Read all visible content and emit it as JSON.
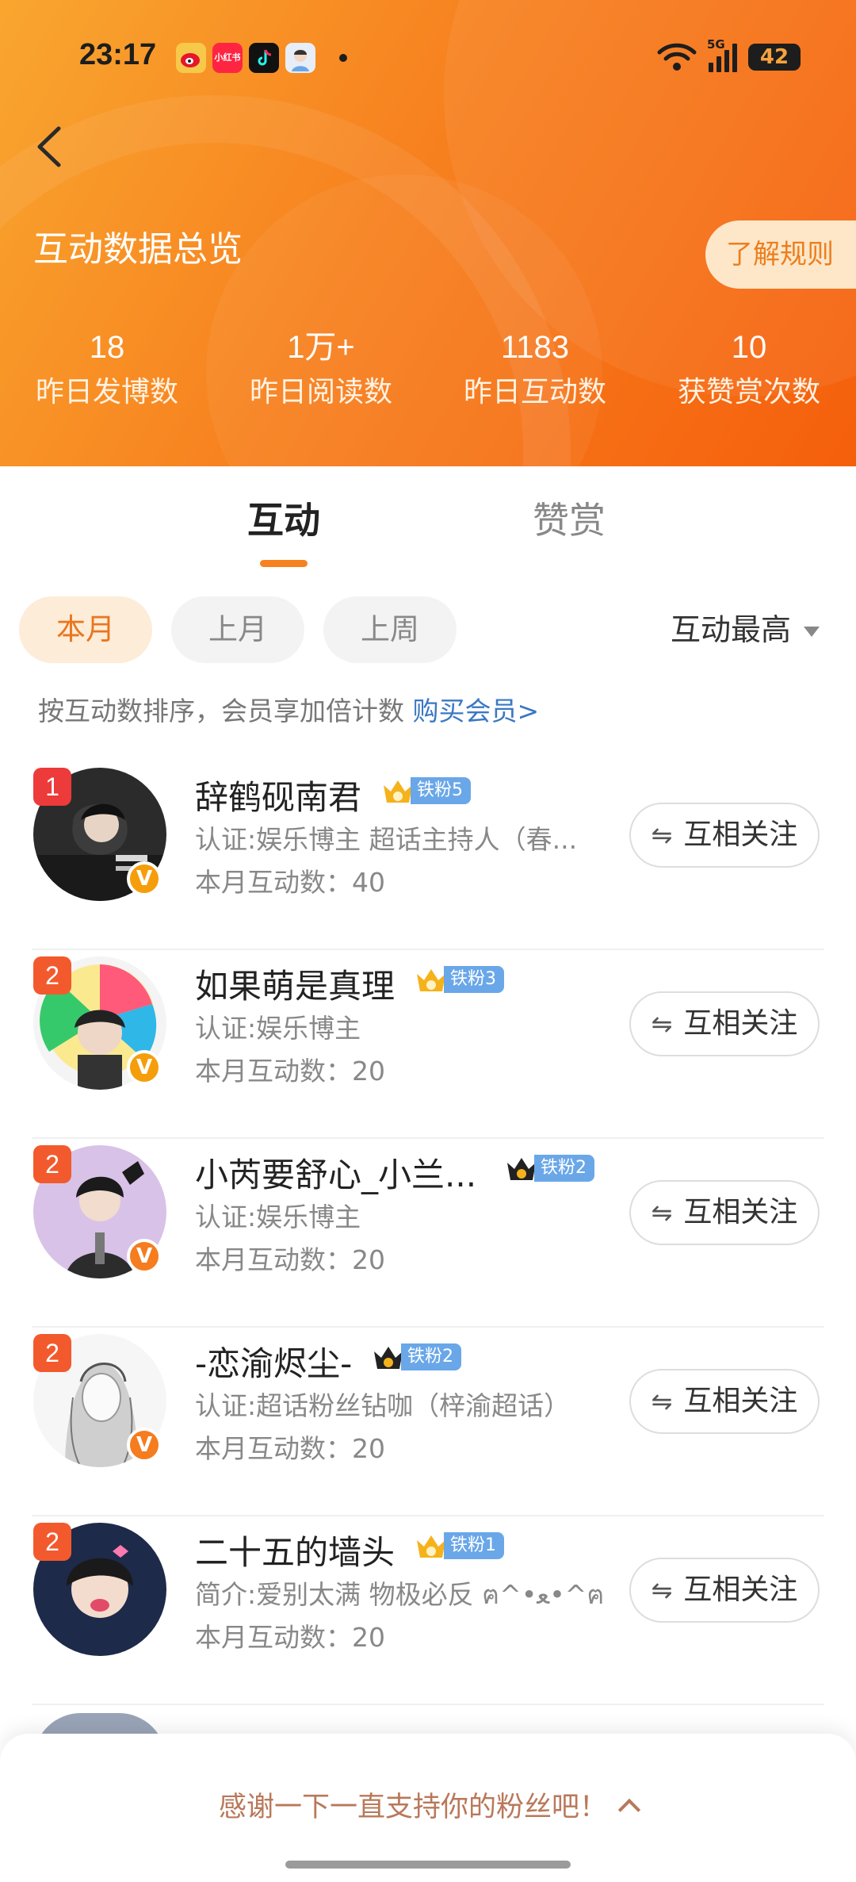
{
  "status_bar": {
    "time": "23:17",
    "apps": [
      "weibo-icon",
      "xiaohongshu-icon",
      "tiktok-icon",
      "avatar-app-icon"
    ],
    "app_labels": [
      "",
      "小红书",
      "",
      ""
    ],
    "network": "5G",
    "battery": "42"
  },
  "header": {
    "title": "互动数据总览",
    "rules_button": "了解规则",
    "stats": [
      {
        "value": "18",
        "label": "昨日发博数"
      },
      {
        "value": "1万+",
        "label": "昨日阅读数"
      },
      {
        "value": "1183",
        "label": "昨日互动数"
      },
      {
        "value": "10",
        "label": "获赞赏次数"
      }
    ]
  },
  "tabs": [
    {
      "label": "互动",
      "active": true
    },
    {
      "label": "赞赏",
      "active": false
    }
  ],
  "filters": [
    {
      "label": "本月",
      "active": true
    },
    {
      "label": "上月",
      "active": false
    },
    {
      "label": "上周",
      "active": false
    }
  ],
  "sort": {
    "label": "互动最高"
  },
  "hint": {
    "text": "按互动数排序，会员享加倍计数 ",
    "link": "购买会员>"
  },
  "list": [
    {
      "rank": "1",
      "name": "辞鹤砚南君",
      "fan_level": "铁粉5",
      "subtitle": "认证:娱乐博主 超话主持人（春...",
      "count": "本月互动数：40",
      "button": "互相关注",
      "crown_color": "#f5b21b"
    },
    {
      "rank": "2",
      "name": "如果萌是真理",
      "fan_level": "铁粉3",
      "subtitle": "认证:娱乐博主",
      "count": "本月互动数：20",
      "button": "互相关注",
      "crown_color": "#f5b21b"
    },
    {
      "rank": "2",
      "name": "小芮要舒心_小兰...",
      "fan_level": "铁粉2",
      "subtitle": "认证:娱乐博主",
      "count": "本月互动数：20",
      "button": "互相关注",
      "crown_color": "#222222"
    },
    {
      "rank": "2",
      "name": "-恋渝烬尘-",
      "fan_level": "铁粉2",
      "subtitle": "认证:超话粉丝钻咖（梓渝超话）",
      "count": "本月互动数：20",
      "button": "互相关注",
      "crown_color": "#222222"
    },
    {
      "rank": "2",
      "name": "二十五的墙头",
      "fan_level": "铁粉1",
      "subtitle": "简介:爱别太满 物极必反 ฅ^•ﻌ•^ฅ",
      "count": "本月互动数：20",
      "button": "互相关注",
      "crown_color": "#f5b21b"
    }
  ],
  "bottom_sheet": {
    "text": "感谢一下一直支持你的粉丝吧！"
  },
  "colors": {
    "brand_orange": "#f7811f",
    "link_blue": "#3b78c3",
    "rank_red": "#f25a2e"
  }
}
